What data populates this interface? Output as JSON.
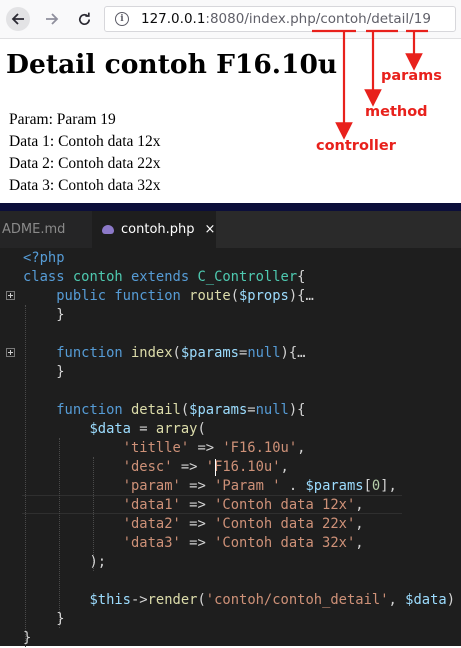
{
  "browser": {
    "url_host": "127.0.0.1",
    "url_rest": ":8080/index.php/contoh/detail/19",
    "colors": {
      "toolbar_bg": "#f9f9fa"
    }
  },
  "page": {
    "title": "Detail contoh F16.10u",
    "lines": [
      "Param: Param 19",
      "Data 1: Contoh data 12x",
      "Data 2: Contoh data 22x",
      "Data 3: Contoh data 32x"
    ]
  },
  "annotations": {
    "params": "params",
    "method": "method",
    "controller": "controller",
    "color": "#e8211c"
  },
  "editor": {
    "tabs": [
      {
        "label": "ADME.md",
        "active": false
      },
      {
        "label": "contoh.php",
        "active": true
      }
    ],
    "code_lines": [
      [
        [
          "<?php",
          "tag"
        ]
      ],
      [
        [
          "class ",
          "kw"
        ],
        [
          "contoh ",
          "cls"
        ],
        [
          "extends ",
          "kw"
        ],
        [
          "C_Controller",
          "cls"
        ],
        [
          "{",
          "op"
        ]
      ],
      [
        [
          "    public ",
          "kw"
        ],
        [
          "function ",
          "kw"
        ],
        [
          "route",
          "fn"
        ],
        [
          "(",
          "op"
        ],
        [
          "$props",
          "var"
        ],
        [
          "){…",
          "op"
        ]
      ],
      [
        [
          "    }",
          "op"
        ]
      ],
      [],
      [
        [
          "    function ",
          "kw"
        ],
        [
          "index",
          "fn"
        ],
        [
          "(",
          "op"
        ],
        [
          "$params",
          "var"
        ],
        [
          "=",
          "op"
        ],
        [
          "null",
          "kw"
        ],
        [
          "){…",
          "op"
        ]
      ],
      [
        [
          "    }",
          "op"
        ]
      ],
      [],
      [
        [
          "    function ",
          "kw"
        ],
        [
          "detail",
          "fn"
        ],
        [
          "(",
          "op"
        ],
        [
          "$params",
          "var"
        ],
        [
          "=",
          "op"
        ],
        [
          "null",
          "kw"
        ],
        [
          "){",
          "op"
        ]
      ],
      [
        [
          "        ",
          "op"
        ],
        [
          "$data",
          "var"
        ],
        [
          " = ",
          "op"
        ],
        [
          "array",
          "fn"
        ],
        [
          "(",
          "op"
        ]
      ],
      [
        [
          "            ",
          "op"
        ],
        [
          "'titlle'",
          "str"
        ],
        [
          " => ",
          "op"
        ],
        [
          "'F16.10u'",
          "str"
        ],
        [
          ",",
          "op"
        ]
      ],
      [
        [
          "            ",
          "op"
        ],
        [
          "'desc'",
          "str"
        ],
        [
          " => ",
          "op"
        ],
        [
          "'F16.10u'",
          "str"
        ],
        [
          ",",
          "op"
        ]
      ],
      [
        [
          "            ",
          "op"
        ],
        [
          "'param'",
          "str"
        ],
        [
          " => ",
          "op"
        ],
        [
          "'Param '",
          "str"
        ],
        [
          " . ",
          "op"
        ],
        [
          "$params",
          "var"
        ],
        [
          "[",
          "op"
        ],
        [
          "0",
          "num"
        ],
        [
          "],",
          "op"
        ]
      ],
      [
        [
          "            ",
          "op"
        ],
        [
          "'data1'",
          "str"
        ],
        [
          " => ",
          "op"
        ],
        [
          "'Contoh data 12x'",
          "str"
        ],
        [
          ",",
          "op"
        ]
      ],
      [
        [
          "            ",
          "op"
        ],
        [
          "'data2'",
          "str"
        ],
        [
          " => ",
          "op"
        ],
        [
          "'Contoh data 22x'",
          "str"
        ],
        [
          ",",
          "op"
        ]
      ],
      [
        [
          "            ",
          "op"
        ],
        [
          "'data3'",
          "str"
        ],
        [
          " => ",
          "op"
        ],
        [
          "'Contoh data 32x'",
          "str"
        ],
        [
          ",",
          "op"
        ]
      ],
      [
        [
          "        );",
          "op"
        ]
      ],
      [],
      [
        [
          "        ",
          "op"
        ],
        [
          "$this",
          "var"
        ],
        [
          "->",
          "op"
        ],
        [
          "render",
          "fn"
        ],
        [
          "(",
          "op"
        ],
        [
          "'contoh/contoh_detail'",
          "str"
        ],
        [
          ", ",
          "op"
        ],
        [
          "$data",
          "var"
        ],
        [
          ")",
          "op"
        ]
      ],
      [
        [
          "    }",
          "op"
        ]
      ],
      [
        [
          "}",
          "op"
        ]
      ]
    ],
    "colors": {
      "kw": "#569cd6",
      "cls": "#4ec9b0",
      "fn": "#dcdcaa",
      "var": "#9cdcfe",
      "str": "#ce9178",
      "num": "#b5cea8"
    }
  }
}
